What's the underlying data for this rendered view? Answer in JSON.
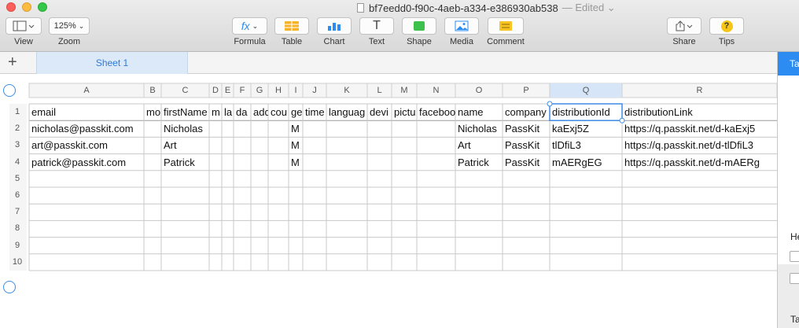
{
  "window": {
    "filename": "bf7eedd0-f90c-4aeb-a334-e386930ab538",
    "edited": "— Edited ⌄"
  },
  "toolbar": {
    "view": "View",
    "zoom_value": "125%",
    "zoom": "Zoom",
    "formula": "Formula",
    "table": "Table",
    "chart": "Chart",
    "text": "Text",
    "shape": "Shape",
    "media": "Media",
    "comment": "Comment",
    "share": "Share",
    "tips": "Tips",
    "formula_glyph": "fx",
    "text_glyph": "T",
    "tips_glyph": "?"
  },
  "tabs": {
    "add": "+",
    "sheet": "Sheet 1"
  },
  "sidebar": {
    "tab": "Ta",
    "label_top": "He",
    "label_bottom": "Ta"
  },
  "columns": [
    "A",
    "B",
    "C",
    "D",
    "E",
    "F",
    "G",
    "H",
    "I",
    "J",
    "K",
    "L",
    "M",
    "N",
    "O",
    "P",
    "Q",
    "R"
  ],
  "rows": [
    "1",
    "2",
    "3",
    "4",
    "5",
    "6",
    "7",
    "8",
    "9",
    "10"
  ],
  "cells": [
    [
      "email",
      "mo",
      "firstName",
      "m",
      "la",
      "da",
      "add",
      "cou",
      "ge",
      "time",
      "languag",
      "devi",
      "pictu",
      "faceboo",
      "name",
      "company",
      "distributionId",
      "distributionLink"
    ],
    [
      "nicholas@passkit.com",
      "",
      "Nicholas",
      "",
      "",
      "",
      "",
      "",
      "M",
      "",
      "",
      "",
      "",
      "",
      "Nicholas",
      "PassKit",
      "kaExj5Z",
      "https://q.passkit.net/d-kaExj5"
    ],
    [
      "art@passkit.com",
      "",
      "Art",
      "",
      "",
      "",
      "",
      "",
      "M",
      "",
      "",
      "",
      "",
      "",
      "Art",
      "PassKit",
      "tlDfiL3",
      "https://q.passkit.net/d-tlDfiL3"
    ],
    [
      "patrick@passkit.com",
      "",
      "Patrick",
      "",
      "",
      "",
      "",
      "",
      "M",
      "",
      "",
      "",
      "",
      "",
      "Patrick",
      "PassKit",
      "mAERgEG",
      "https://q.passkit.net/d-mAERg"
    ],
    [
      "",
      "",
      "",
      "",
      "",
      "",
      "",
      "",
      "",
      "",
      "",
      "",
      "",
      "",
      "",
      "",
      "",
      ""
    ],
    [
      "",
      "",
      "",
      "",
      "",
      "",
      "",
      "",
      "",
      "",
      "",
      "",
      "",
      "",
      "",
      "",
      "",
      ""
    ],
    [
      "",
      "",
      "",
      "",
      "",
      "",
      "",
      "",
      "",
      "",
      "",
      "",
      "",
      "",
      "",
      "",
      "",
      ""
    ],
    [
      "",
      "",
      "",
      "",
      "",
      "",
      "",
      "",
      "",
      "",
      "",
      "",
      "",
      "",
      "",
      "",
      "",
      ""
    ],
    [
      "",
      "",
      "",
      "",
      "",
      "",
      "",
      "",
      "",
      "",
      "",
      "",
      "",
      "",
      "",
      "",
      "",
      ""
    ],
    [
      "",
      "",
      "",
      "",
      "",
      "",
      "",
      "",
      "",
      "",
      "",
      "",
      "",
      "",
      "",
      "",
      "",
      ""
    ]
  ],
  "selected_cell": "Q1",
  "colors": {
    "accent": "#2c8cf2",
    "selection": "#3d8ce6",
    "header_row_fill": "#ffffff"
  }
}
